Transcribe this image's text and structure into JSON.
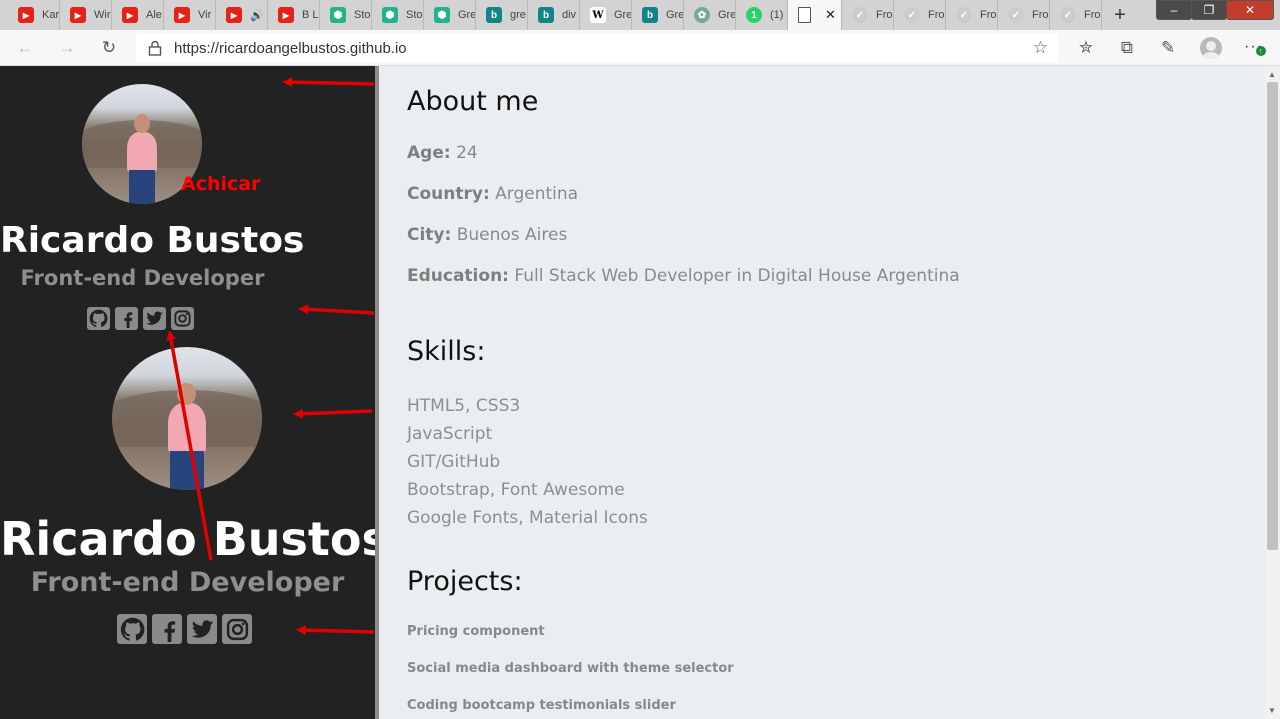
{
  "browser": {
    "tabs": [
      {
        "title": "Kar",
        "icon": "youtube-icon",
        "color": "#e62117"
      },
      {
        "title": "Wir",
        "icon": "youtube-icon",
        "color": "#e62117"
      },
      {
        "title": "Ale",
        "icon": "youtube-icon",
        "color": "#e62117"
      },
      {
        "title": "Vir",
        "icon": "youtube-icon",
        "color": "#e62117"
      },
      {
        "title": "",
        "icon": "youtube-icon",
        "color": "#e62117",
        "audio": true
      },
      {
        "title": "B L",
        "icon": "youtube-icon",
        "color": "#e62117"
      },
      {
        "title": "Sto",
        "icon": "stackshare-icon",
        "color": "#1fb489"
      },
      {
        "title": "Sto",
        "icon": "stackshare-icon",
        "color": "#1fb489"
      },
      {
        "title": "Gre",
        "icon": "stackshare-icon",
        "color": "#1fb489"
      },
      {
        "title": "gre",
        "icon": "bing-icon",
        "color": "#128489"
      },
      {
        "title": "div",
        "icon": "bing-icon",
        "color": "#128489"
      },
      {
        "title": "Gre",
        "icon": "wikipedia-icon",
        "color": "#ffffff"
      },
      {
        "title": "Gre",
        "icon": "bing-icon",
        "color": "#128489"
      },
      {
        "title": "Gre",
        "icon": "chatgpt-icon",
        "color": "#74aa9c"
      },
      {
        "title": "(1)",
        "icon": "whatsapp-icon",
        "color": "#25d366"
      },
      {
        "title": "",
        "icon": "page-icon",
        "color": "#ffffff",
        "active": true
      },
      {
        "title": "Fro",
        "icon": "frontendmentor-icon",
        "color": "#ffffff"
      },
      {
        "title": "Fro",
        "icon": "frontendmentor-icon",
        "color": "#ffffff"
      },
      {
        "title": "Fro",
        "icon": "frontendmentor-icon",
        "color": "#ffffff"
      },
      {
        "title": "Fro",
        "icon": "frontendmentor-icon",
        "color": "#ffffff"
      },
      {
        "title": "Fro",
        "icon": "frontendmentor-icon",
        "color": "#ffffff"
      }
    ],
    "url": "https://ricardoangelbustos.github.io"
  },
  "sidebar": {
    "small": {
      "name": "Ricardo Bustos",
      "role": "Front-end Developer"
    },
    "large": {
      "name": "Ricardo Bustos",
      "role": "Front-end Developer"
    },
    "social_icons": [
      "github-icon",
      "facebook-icon",
      "twitter-icon",
      "instagram-icon"
    ],
    "annotation": "Achicar",
    "annotation_color": "#ff0000"
  },
  "about": {
    "heading": "About me",
    "age_label": "Age:",
    "age_value": "24",
    "country_label": "Country:",
    "country_value": "Argentina",
    "city_label": "City:",
    "city_value": "Buenos Aires",
    "education_label": "Education:",
    "education_value": "Full Stack Web Developer in Digital House Argentina"
  },
  "skills": {
    "heading": "Skills:",
    "items": [
      "HTML5, CSS3",
      "JavaScript",
      "GIT/GitHub",
      "Bootstrap, Font Awesome",
      "Google Fonts, Material Icons"
    ]
  },
  "projects": {
    "heading": "Projects:",
    "items": [
      "Pricing component",
      "Social media dashboard with theme selector",
      "Coding bootcamp testimonials slider"
    ]
  },
  "colors": {
    "sidebar_bg": "#222222",
    "main_bg": "#ebeef0",
    "arrow": "#e00000"
  }
}
